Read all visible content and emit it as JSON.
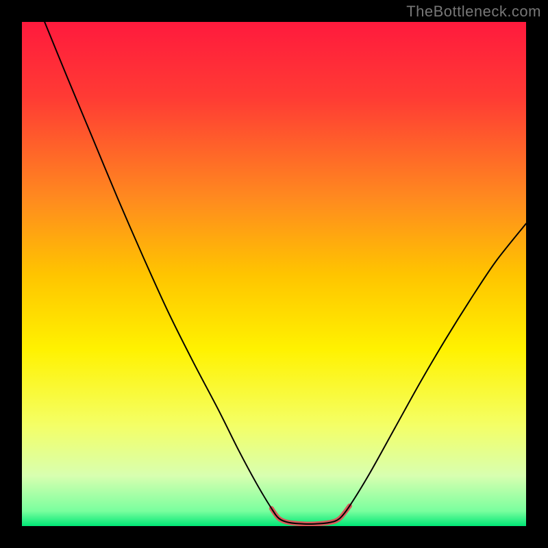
{
  "watermark": "TheBottleneck.com",
  "chart_data": {
    "type": "line",
    "title": "",
    "xlabel": "",
    "ylabel": "",
    "xlim": [
      0,
      100
    ],
    "ylim": [
      0,
      100
    ],
    "background_gradient": {
      "stops": [
        {
          "offset": 0.0,
          "color": "#ff1a3d"
        },
        {
          "offset": 0.15,
          "color": "#ff3b34"
        },
        {
          "offset": 0.35,
          "color": "#ff8a1f"
        },
        {
          "offset": 0.5,
          "color": "#ffc400"
        },
        {
          "offset": 0.65,
          "color": "#fff200"
        },
        {
          "offset": 0.8,
          "color": "#f4ff66"
        },
        {
          "offset": 0.9,
          "color": "#d8ffb0"
        },
        {
          "offset": 0.97,
          "color": "#7aff9e"
        },
        {
          "offset": 1.0,
          "color": "#00e676"
        }
      ]
    },
    "series": [
      {
        "name": "bottleneck-curve",
        "type": "line",
        "stroke": "#000000",
        "stroke_width": 2,
        "points": [
          {
            "x": 4.5,
            "y": 100.0
          },
          {
            "x": 9.0,
            "y": 89.0
          },
          {
            "x": 14.0,
            "y": 77.0
          },
          {
            "x": 19.0,
            "y": 65.0
          },
          {
            "x": 24.0,
            "y": 53.5
          },
          {
            "x": 29.0,
            "y": 42.5
          },
          {
            "x": 34.0,
            "y": 32.5
          },
          {
            "x": 39.0,
            "y": 23.0
          },
          {
            "x": 43.0,
            "y": 15.0
          },
          {
            "x": 46.5,
            "y": 8.5
          },
          {
            "x": 49.5,
            "y": 3.5
          },
          {
            "x": 51.0,
            "y": 1.5
          },
          {
            "x": 53.0,
            "y": 0.7
          },
          {
            "x": 57.0,
            "y": 0.4
          },
          {
            "x": 61.0,
            "y": 0.7
          },
          {
            "x": 63.0,
            "y": 1.5
          },
          {
            "x": 65.0,
            "y": 4.0
          },
          {
            "x": 69.0,
            "y": 10.5
          },
          {
            "x": 74.0,
            "y": 19.5
          },
          {
            "x": 79.0,
            "y": 28.5
          },
          {
            "x": 84.0,
            "y": 37.0
          },
          {
            "x": 89.0,
            "y": 45.0
          },
          {
            "x": 94.0,
            "y": 52.5
          },
          {
            "x": 100.0,
            "y": 60.0
          }
        ]
      },
      {
        "name": "valley-highlight",
        "type": "line",
        "stroke": "#d85a5a",
        "stroke_width": 7,
        "points": [
          {
            "x": 49.5,
            "y": 3.5
          },
          {
            "x": 51.0,
            "y": 1.5
          },
          {
            "x": 53.0,
            "y": 0.7
          },
          {
            "x": 57.0,
            "y": 0.4
          },
          {
            "x": 61.0,
            "y": 0.7
          },
          {
            "x": 63.0,
            "y": 1.5
          },
          {
            "x": 65.0,
            "y": 4.0
          }
        ]
      }
    ]
  }
}
